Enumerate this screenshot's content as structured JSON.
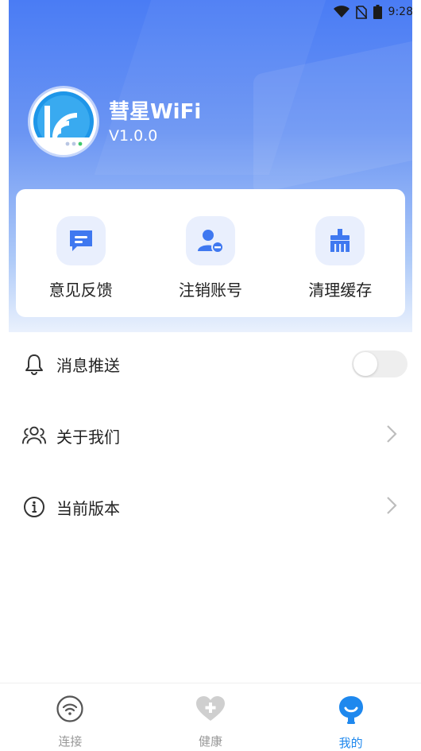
{
  "status_bar": {
    "time": "9:28"
  },
  "app": {
    "name": "彗星WiFi",
    "version": "V1.0.0"
  },
  "quick_actions": [
    {
      "label": "意见反馈",
      "icon": "feedback-icon"
    },
    {
      "label": "注销账号",
      "icon": "user-remove-icon"
    },
    {
      "label": "清理缓存",
      "icon": "broom-icon"
    }
  ],
  "settings": [
    {
      "label": "消息推送",
      "icon": "bell-icon",
      "control": "toggle",
      "value": false
    },
    {
      "label": "关于我们",
      "icon": "users-icon",
      "control": "chevron"
    },
    {
      "label": "当前版本",
      "icon": "info-icon",
      "control": "chevron"
    }
  ],
  "tabs": [
    {
      "label": "连接",
      "icon": "wifi-icon",
      "active": false
    },
    {
      "label": "健康",
      "icon": "heart-plus-icon",
      "active": false
    },
    {
      "label": "我的",
      "icon": "profile-icon",
      "active": true
    }
  ],
  "colors": {
    "primary": "#4a7cf4",
    "accent": "#1e88ee",
    "icon_blue": "#3f78f0"
  }
}
